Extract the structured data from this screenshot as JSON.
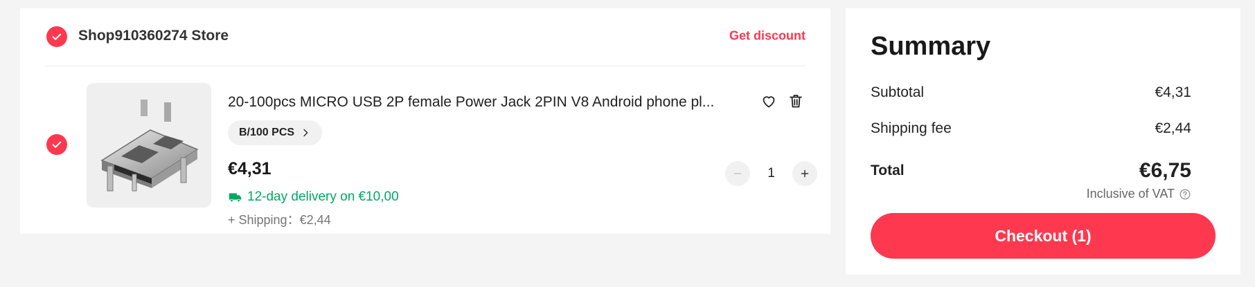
{
  "store": {
    "name": "Shop910360274 Store",
    "get_discount_label": "Get discount"
  },
  "item": {
    "title": "20-100pcs MICRO USB 2P female Power Jack 2PIN V8 Android phone pl...",
    "variant": "B/100 PCS",
    "price": "€4,31",
    "delivery": "12-day delivery on €10,00",
    "shipping": "+ Shipping：€2,44",
    "quantity": "1"
  },
  "summary": {
    "title": "Summary",
    "subtotal_label": "Subtotal",
    "subtotal_value": "€4,31",
    "shipping_label": "Shipping fee",
    "shipping_value": "€2,44",
    "total_label": "Total",
    "total_value": "€6,75",
    "vat_note": "Inclusive of VAT",
    "checkout_label": "Checkout (1)"
  },
  "colors": {
    "accent": "#fd384f",
    "delivery_green": "#00a862",
    "background": "#f4f4f4"
  },
  "icons": {
    "check": "check-icon",
    "heart": "heart-icon",
    "trash": "trash-icon",
    "chevron": "chevron-right-icon",
    "truck": "truck-icon",
    "help": "help-icon",
    "minus": "minus-icon",
    "plus": "plus-icon"
  }
}
